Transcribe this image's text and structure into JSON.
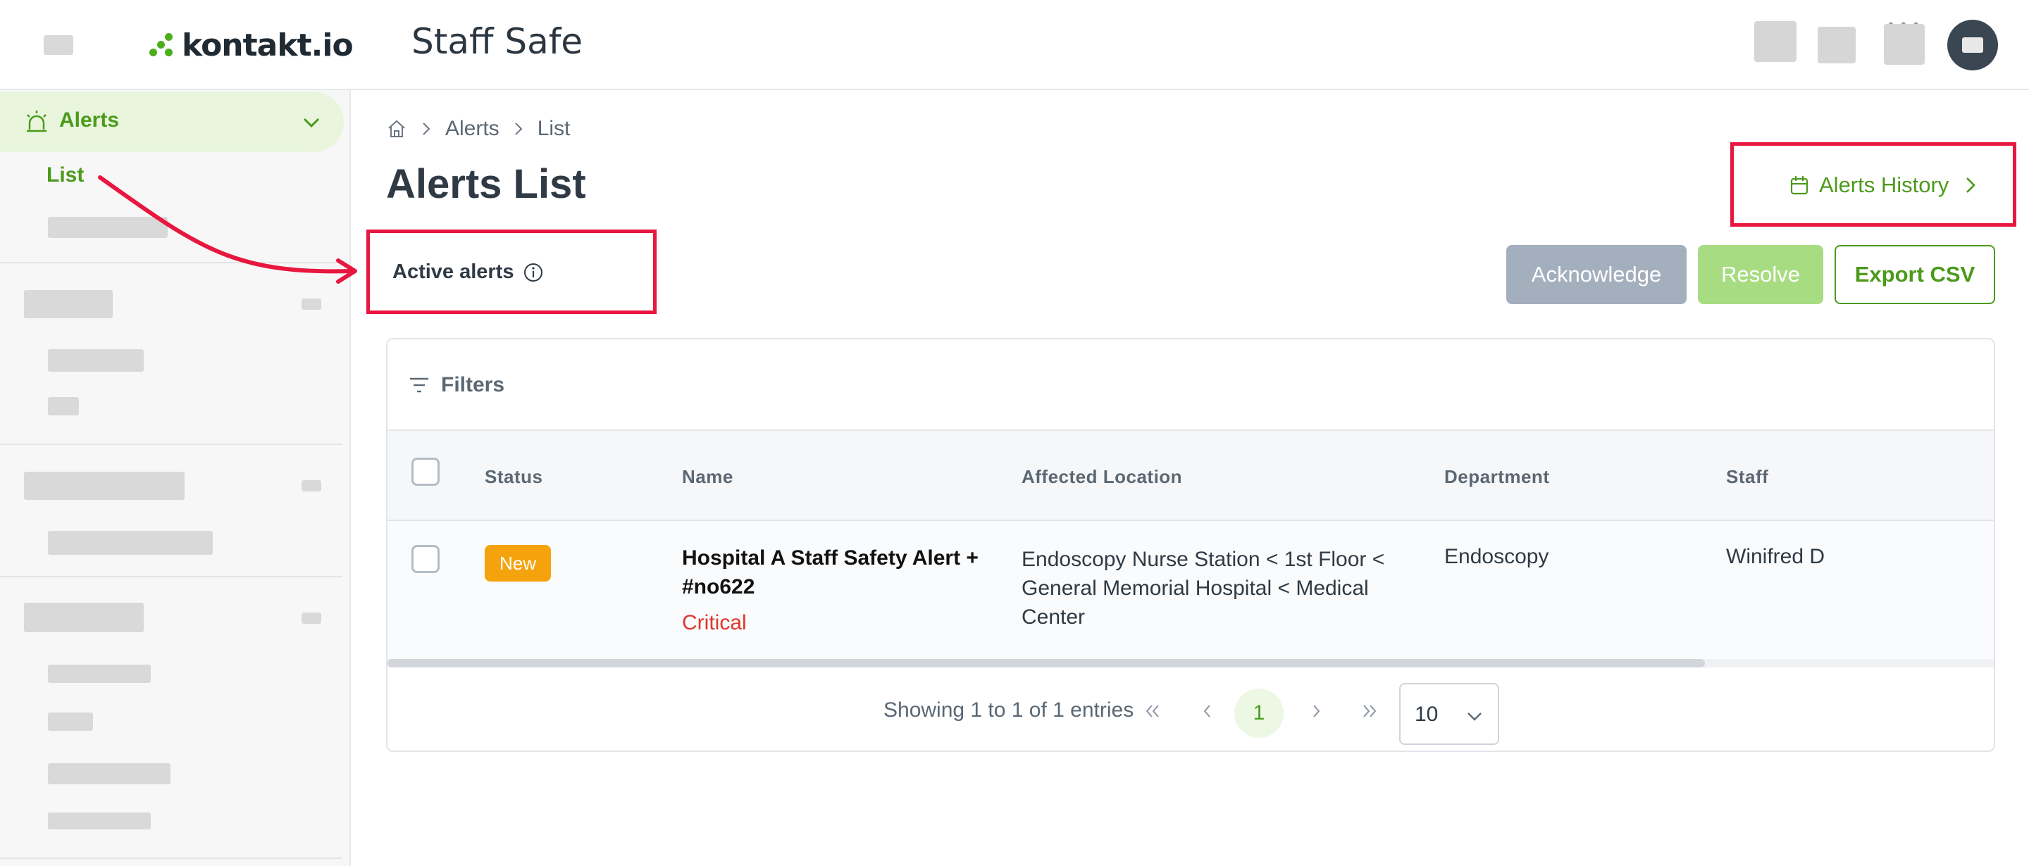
{
  "app": {
    "logo_text": "kontakt.io",
    "title": "Staff Safe"
  },
  "sidebar": {
    "alerts_label": "Alerts",
    "list_label": "List"
  },
  "breadcrumb": {
    "items": [
      "Alerts",
      "List"
    ]
  },
  "page": {
    "title": "Alerts List",
    "section_title": "Active alerts",
    "history_link": "Alerts History"
  },
  "actions": {
    "acknowledge": "Acknowledge",
    "resolve": "Resolve",
    "export": "Export CSV"
  },
  "filters": {
    "label": "Filters"
  },
  "table": {
    "columns": [
      "Status",
      "Name",
      "Affected Location",
      "Department",
      "Staff"
    ],
    "rows": [
      {
        "status": "New",
        "name": "Hospital A Staff Safety Alert + #no622",
        "severity": "Critical",
        "location": "Endoscopy Nurse Station < 1st Floor < General Memorial Hospital < Medical Center",
        "department": "Endoscopy",
        "staff": "Winifred D"
      }
    ]
  },
  "pagination": {
    "info": "Showing 1 to 1 of 1 entries",
    "current_page": "1",
    "page_size": "10"
  },
  "colors": {
    "accent": "#4c9a1c",
    "highlight": "#e8173f",
    "status_new": "#f5a30c",
    "critical": "#e0362c"
  }
}
